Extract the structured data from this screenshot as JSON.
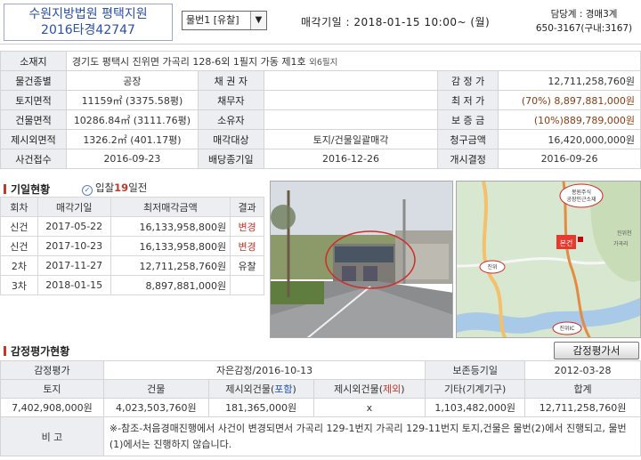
{
  "header": {
    "court": "수원지방법원 평택지원",
    "case_no": "2016타경42747",
    "item_select": "물번1 [유찰]",
    "auction_date": "매각기일 : 2018-01-15   10:00~ (월)",
    "manager_line1": "담당계 : 경매3계",
    "manager_line2": "650-3167(구내:3167)"
  },
  "info": {
    "address_label": "소재지",
    "address": "경기도 평택시 진위면 가곡리 128-6외 1필지 가동 제1호",
    "address_extra": "외6필지",
    "rows": [
      [
        "물건종별",
        "공장",
        "채 권 자",
        "",
        "감 정 가",
        "12,711,258,760원"
      ],
      [
        "토지면적",
        "11159㎡ (3375.58평)",
        "채무자",
        "",
        "최 저 가",
        "(70%) 8,897,881,000원"
      ],
      [
        "건물면적",
        "10286.84㎡ (3111.76평)",
        "소유자",
        "",
        "보 증 금",
        "(10%)889,789,000원"
      ],
      [
        "제시외면적",
        "1326.2㎡ (401.17평)",
        "매각대상",
        "토지/건물일괄매각",
        "청구금액",
        "16,420,000,000원"
      ],
      [
        "사건접수",
        "2016-09-23",
        "배당종기일",
        "2016-12-26",
        "개시결정",
        "2016-09-26"
      ]
    ]
  },
  "history": {
    "title": "기일현황",
    "bid_prefix": "입찰",
    "bid_days": "19",
    "bid_suffix": "일전",
    "headers": [
      "회차",
      "매각기일",
      "최저매각금액",
      "결과"
    ],
    "rows": [
      [
        "신건",
        "2017-05-22",
        "16,133,958,800원",
        "변경"
      ],
      [
        "신건",
        "2017-10-23",
        "16,133,958,800원",
        "변경"
      ],
      [
        "2차",
        "2017-11-27",
        "12,711,258,760원",
        "유찰"
      ],
      [
        "3차",
        "2018-01-15",
        "8,897,881,000원",
        ""
      ]
    ]
  },
  "map": {
    "badge": "본건",
    "top_label1": "봉원주식",
    "top_label2": "공장인근소재",
    "side_label1": "진위천",
    "side_label2": "가곡리",
    "bottom_label": "진위IC",
    "left_label": "진위"
  },
  "appraisal": {
    "title": "감정평가현황",
    "button": "감정평가서",
    "label": "감정평가",
    "appraiser": "자은감정/2016-10-13",
    "reg_label": "보존등기일",
    "reg_date": "2012-03-28",
    "col_land": "토지",
    "col_building": "건물",
    "col_extra_in_prefix": "제시외건물(",
    "col_extra_in_mid": "포함",
    "col_extra_out_prefix": "제시외건물(",
    "col_extra_out_mid": "제외",
    "col_suffix": ")",
    "col_other": "기타(기계기구)",
    "col_total": "합계",
    "val_land": "7,402,908,000원",
    "val_building": "4,023,503,760원",
    "val_extra_in": "181,365,000원",
    "val_extra_out": "x",
    "val_other": "1,103,482,000원",
    "val_total": "12,711,258,760원",
    "note_label": "비 고",
    "note": "※-참조-처음경매진행에서 사건이 변경되면서 가곡리 129-1번지 가곡리 129-11번지 토지,건물은 물번(2)에서 진행되고, 물번(1)에서는 진행하지 않습니다."
  },
  "colors": {
    "title_blue": "#2a4fa8",
    "label_bg": "#eceef1",
    "accent_red": "#c0392b",
    "price_brown": "#8a3a10"
  }
}
